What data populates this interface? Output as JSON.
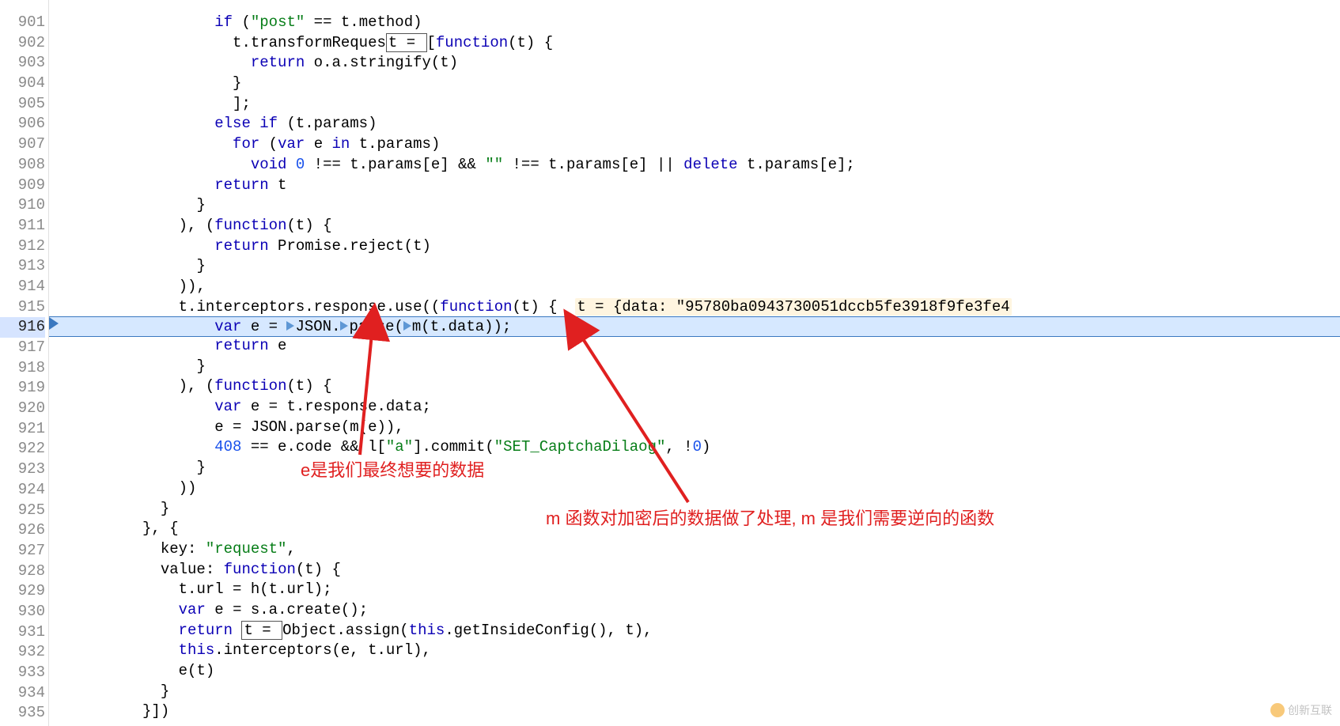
{
  "gutter": {
    "start": 901,
    "end": 935,
    "current_line": 916
  },
  "code": {
    "901": {
      "indent": 18,
      "segments": [
        {
          "t": "if",
          "c": "kw"
        },
        {
          "t": " ("
        },
        {
          "t": "\"post\"",
          "c": "str"
        },
        {
          "t": " == t.method)"
        }
      ]
    },
    "902": {
      "indent": 20,
      "segments": [
        {
          "t": "t.transformReques"
        },
        {
          "t": "t = ",
          "c": "box"
        },
        {
          "t": "["
        },
        {
          "t": "function",
          "c": "kw"
        },
        {
          "t": "(t) {"
        }
      ]
    },
    "903": {
      "indent": 22,
      "segments": [
        {
          "t": "return",
          "c": "kw"
        },
        {
          "t": " o.a.stringify(t)"
        }
      ]
    },
    "904": {
      "indent": 20,
      "segments": [
        {
          "t": "}"
        }
      ]
    },
    "905": {
      "indent": 20,
      "segments": [
        {
          "t": "];"
        }
      ]
    },
    "906": {
      "indent": 18,
      "segments": [
        {
          "t": "else if",
          "c": "kw"
        },
        {
          "t": " (t.params)"
        }
      ]
    },
    "907": {
      "indent": 20,
      "segments": [
        {
          "t": "for",
          "c": "kw"
        },
        {
          "t": " ("
        },
        {
          "t": "var",
          "c": "kw"
        },
        {
          "t": " e "
        },
        {
          "t": "in",
          "c": "kw"
        },
        {
          "t": " t.params)"
        }
      ]
    },
    "908": {
      "indent": 22,
      "segments": [
        {
          "t": "void",
          "c": "kw"
        },
        {
          "t": " "
        },
        {
          "t": "0",
          "c": "num"
        },
        {
          "t": " !== t.params[e] && "
        },
        {
          "t": "\"\"",
          "c": "str"
        },
        {
          "t": " !== t.params[e] || "
        },
        {
          "t": "delete",
          "c": "kw"
        },
        {
          "t": " t.params[e];"
        }
      ]
    },
    "909": {
      "indent": 18,
      "segments": [
        {
          "t": "return",
          "c": "kw"
        },
        {
          "t": " t"
        }
      ]
    },
    "910": {
      "indent": 16,
      "segments": [
        {
          "t": "}"
        }
      ]
    },
    "911": {
      "indent": 14,
      "segments": [
        {
          "t": "), ("
        },
        {
          "t": "function",
          "c": "kw"
        },
        {
          "t": "(t) {"
        }
      ]
    },
    "912": {
      "indent": 18,
      "segments": [
        {
          "t": "return",
          "c": "kw"
        },
        {
          "t": " Promise.reject(t)"
        }
      ]
    },
    "913": {
      "indent": 16,
      "segments": [
        {
          "t": "}"
        }
      ]
    },
    "914": {
      "indent": 14,
      "segments": [
        {
          "t": ")),"
        }
      ]
    },
    "915": {
      "indent": 14,
      "segments": [
        {
          "t": "t.interceptors.response.use(("
        },
        {
          "t": "function",
          "c": "kw"
        },
        {
          "t": "(t) {  "
        },
        {
          "t": "t = {data: \"95780ba0943730051dccb5fe3918f9fe3fe4",
          "c": "paramval"
        }
      ]
    },
    "916": {
      "indent": 18,
      "current": true,
      "segments": [
        {
          "t": "var",
          "c": "kw"
        },
        {
          "t": " e = "
        },
        {
          "t": "",
          "c": "expand"
        },
        {
          "t": "JSON."
        },
        {
          "t": "",
          "c": "expand"
        },
        {
          "t": "parse("
        },
        {
          "t": "",
          "c": "expand"
        },
        {
          "t": "m(t.data));"
        }
      ]
    },
    "917": {
      "indent": 18,
      "segments": [
        {
          "t": "return",
          "c": "kw"
        },
        {
          "t": " e"
        }
      ]
    },
    "918": {
      "indent": 16,
      "segments": [
        {
          "t": "}"
        }
      ]
    },
    "919": {
      "indent": 14,
      "segments": [
        {
          "t": "), ("
        },
        {
          "t": "function",
          "c": "kw"
        },
        {
          "t": "(t) {"
        }
      ]
    },
    "920": {
      "indent": 18,
      "segments": [
        {
          "t": "var",
          "c": "kw"
        },
        {
          "t": " e = t.response.data;"
        }
      ]
    },
    "921": {
      "indent": 18,
      "segments": [
        {
          "t": "e = JSON.parse(m(e)),"
        }
      ]
    },
    "922": {
      "indent": 18,
      "segments": [
        {
          "t": "408",
          "c": "num"
        },
        {
          "t": " == e.code && l["
        },
        {
          "t": "\"a\"",
          "c": "str"
        },
        {
          "t": "].commit("
        },
        {
          "t": "\"SET_CaptchaDilaog\"",
          "c": "str"
        },
        {
          "t": ", !"
        },
        {
          "t": "0",
          "c": "num"
        },
        {
          "t": ")"
        }
      ]
    },
    "923": {
      "indent": 16,
      "segments": [
        {
          "t": "}"
        }
      ]
    },
    "924": {
      "indent": 14,
      "segments": [
        {
          "t": "))"
        }
      ]
    },
    "925": {
      "indent": 12,
      "segments": [
        {
          "t": "}"
        }
      ]
    },
    "926": {
      "indent": 10,
      "segments": [
        {
          "t": "}, {"
        }
      ]
    },
    "927": {
      "indent": 12,
      "segments": [
        {
          "t": "key: "
        },
        {
          "t": "\"request\"",
          "c": "str"
        },
        {
          "t": ","
        }
      ]
    },
    "928": {
      "indent": 12,
      "segments": [
        {
          "t": "value: "
        },
        {
          "t": "function",
          "c": "kw"
        },
        {
          "t": "(t) {"
        }
      ]
    },
    "929": {
      "indent": 14,
      "segments": [
        {
          "t": "t.url = h(t.url);"
        }
      ]
    },
    "930": {
      "indent": 14,
      "segments": [
        {
          "t": "var",
          "c": "kw"
        },
        {
          "t": " e = "
        },
        {
          "t": "s",
          "c": "box-underline"
        },
        {
          "t": ".a.create();"
        }
      ]
    },
    "931": {
      "indent": 14,
      "segments": [
        {
          "t": "return",
          "c": "kw"
        },
        {
          "t": " "
        },
        {
          "t": "t = ",
          "c": "box"
        },
        {
          "t": "Object.assign("
        },
        {
          "t": "this",
          "c": "kw"
        },
        {
          "t": ".getInsideConfig(), t),"
        }
      ]
    },
    "932": {
      "indent": 14,
      "segments": [
        {
          "t": "this",
          "c": "kw"
        },
        {
          "t": ".interceptors(e, t.url),"
        }
      ]
    },
    "933": {
      "indent": 14,
      "segments": [
        {
          "t": "e(t)"
        }
      ]
    },
    "934": {
      "indent": 12,
      "segments": [
        {
          "t": "}"
        }
      ]
    },
    "935": {
      "indent": 10,
      "segments": [
        {
          "t": "}])"
        }
      ]
    }
  },
  "annotations": {
    "left_text": "e是我们最终想要的数据",
    "right_text": "m 函数对加密后的数据做了处理, m 是我们需要逆向的函数"
  },
  "watermark": "创新互联"
}
